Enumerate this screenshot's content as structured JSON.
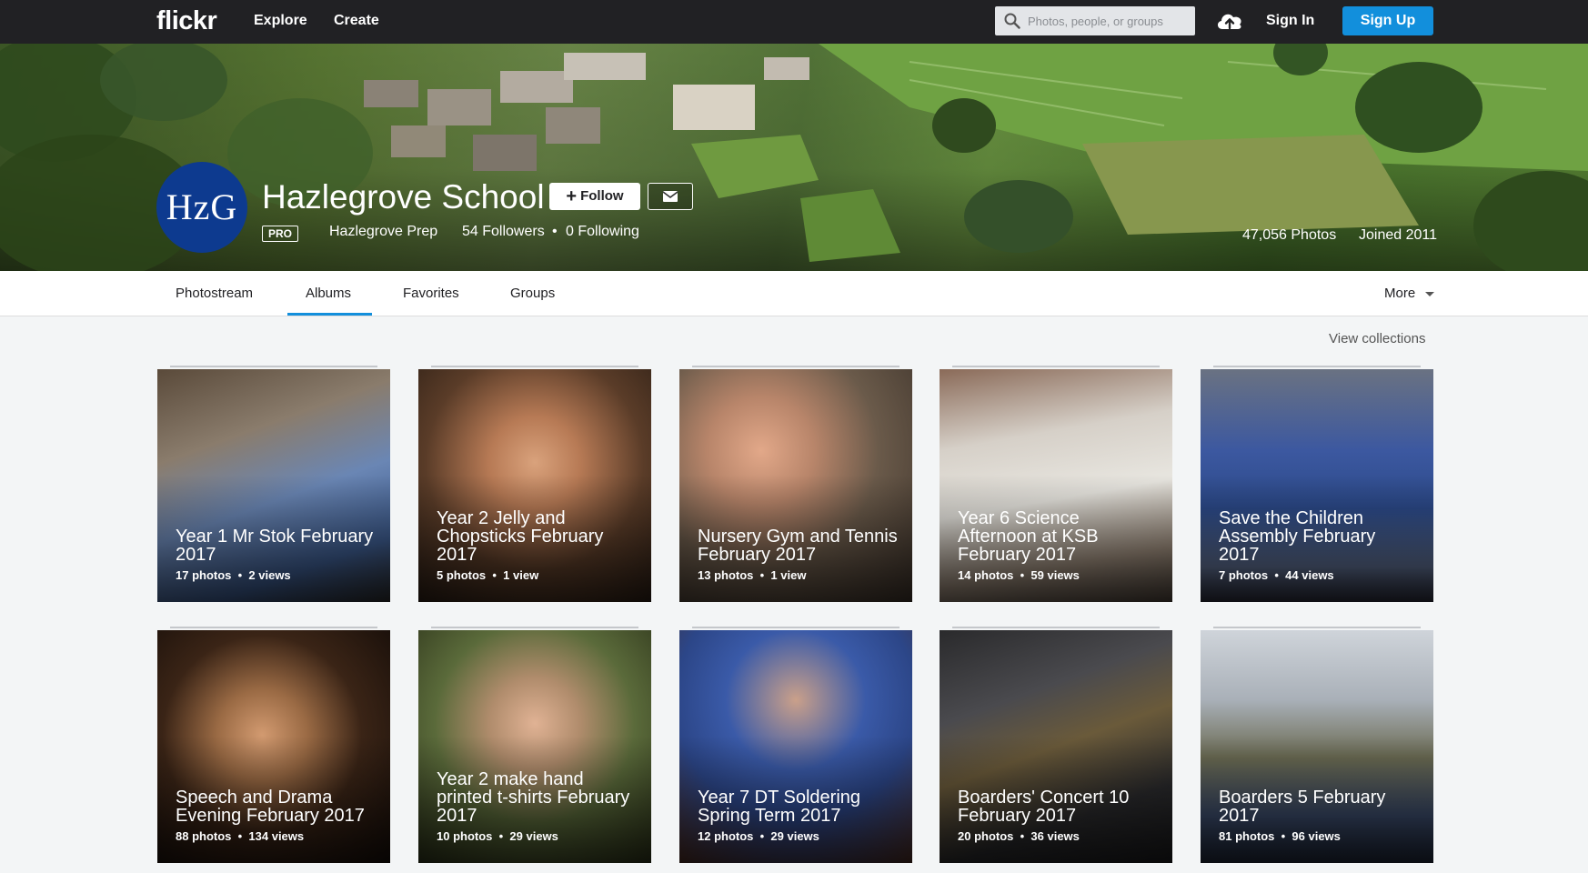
{
  "topnav": {
    "logo": "flickr",
    "explore": "Explore",
    "create": "Create",
    "search_placeholder": "Photos, people, or groups",
    "sign_in": "Sign In",
    "sign_up": "Sign Up"
  },
  "profile": {
    "avatar_text": "HzG",
    "name": "Hazlegrove School",
    "follow_label": "Follow",
    "pro": "PRO",
    "real_name": "Hazlegrove Prep",
    "followers": "54 Followers",
    "following": "0 Following",
    "photos": "47,056 Photos",
    "joined": "Joined 2011"
  },
  "tabs": {
    "photostream": "Photostream",
    "albums": "Albums",
    "favorites": "Favorites",
    "groups": "Groups",
    "more": "More",
    "active": "Albums"
  },
  "view_collections": "View collections",
  "albums": [
    {
      "title": "Year 1 Mr Stok February 2017",
      "photos": "17 photos",
      "views": "2 views"
    },
    {
      "title": "Year 2 Jelly and Chopsticks February 2017",
      "photos": "5 photos",
      "views": "1 view"
    },
    {
      "title": "Nursery Gym and Tennis February 2017",
      "photos": "13 photos",
      "views": "1 view"
    },
    {
      "title": "Year 6 Science Afternoon at KSB February 2017",
      "photos": "14 photos",
      "views": "59 views"
    },
    {
      "title": "Save the Children Assembly February 2017",
      "photos": "7 photos",
      "views": "44 views"
    },
    {
      "title": "Speech and Drama Evening February 2017",
      "photos": "88 photos",
      "views": "134 views"
    },
    {
      "title": "Year 2 make hand printed t-shirts February 2017",
      "photos": "10 photos",
      "views": "29 views"
    },
    {
      "title": "Year 7 DT Soldering Spring Term 2017",
      "photos": "12 photos",
      "views": "29 views"
    },
    {
      "title": "Boarders' Concert 10 February 2017",
      "photos": "20 photos",
      "views": "36 views"
    },
    {
      "title": "Boarders 5 February 2017",
      "photos": "81 photos",
      "views": "96 views"
    }
  ],
  "colors": {
    "nav_bg": "#212124",
    "accent": "#128fdc",
    "avatar_bg": "#0d3a8f"
  },
  "icons": [
    "search-icon",
    "upload-cloud-icon",
    "plus-icon",
    "mail-icon",
    "caret-down-icon"
  ]
}
